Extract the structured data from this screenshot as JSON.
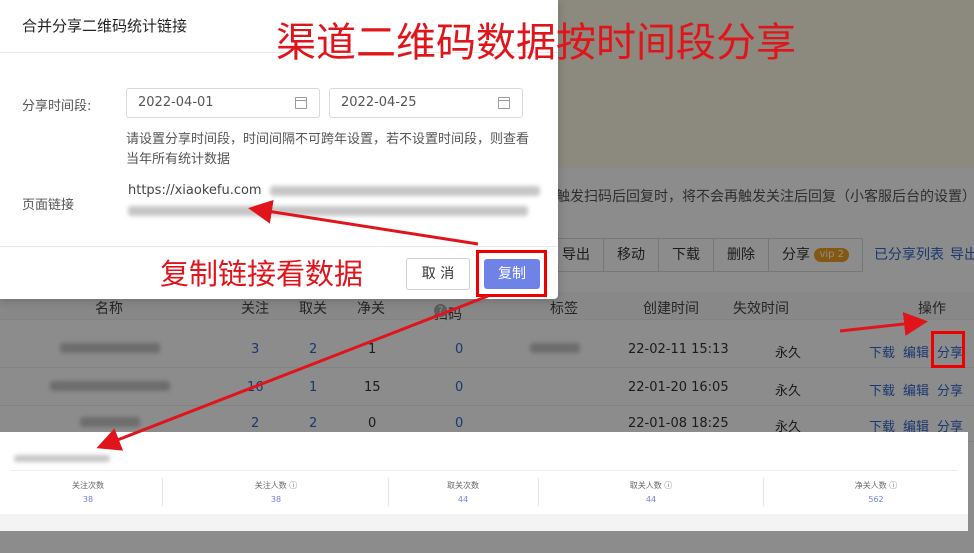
{
  "modal": {
    "title": "合并分享二维码统计链接",
    "period_label": "分享时间段:",
    "start_date": "2022-04-01",
    "end_date": "2022-04-25",
    "hint": "请设置分享时间段，时间间隔不可跨年设置，若不设置时间段，则查看当年所有统计数据",
    "link_label": "页面链接",
    "link_value": "https://xiaokefu.com",
    "cancel_label": "取 消",
    "copy_label": "复制"
  },
  "annotations": {
    "title": "渠道二维码数据按时间段分享",
    "copy_note": "复制链接看数据",
    "color": "#e0151b"
  },
  "background": {
    "notice": "触发扫码后回复时，将不会再触发关注后回复（小客服后台的设置）",
    "toolbar": [
      "导出",
      "移动",
      "下载",
      "删除"
    ],
    "share_button": "分享",
    "vip_badge": "vip 2",
    "links": [
      "已分享列表",
      "导出"
    ],
    "table": {
      "headers": [
        "名称",
        "关注",
        "取关",
        "净关",
        "扫码",
        "标签",
        "创建时间",
        "失效时间",
        "操作"
      ],
      "rows": [
        {
          "follow": "3",
          "unfollow": "2",
          "net": "1",
          "scan": "0",
          "created": "22-02-11 15:13",
          "expire": "永久"
        },
        {
          "follow": "16",
          "unfollow": "1",
          "net": "15",
          "scan": "0",
          "created": "22-01-20 16:05",
          "expire": "永久"
        },
        {
          "follow": "2",
          "unfollow": "2",
          "net": "0",
          "scan": "0",
          "created": "22-01-08 18:25",
          "expire": "永久"
        }
      ],
      "ops": [
        "下载",
        "编辑",
        "分享"
      ]
    }
  },
  "stats": {
    "items": [
      {
        "label": "关注次数",
        "value": "38"
      },
      {
        "label": "关注人数",
        "value": "38"
      },
      {
        "label": "取关次数",
        "value": "44"
      },
      {
        "label": "取关人数",
        "value": "44"
      },
      {
        "label": "净关人数",
        "value": "562"
      }
    ]
  }
}
